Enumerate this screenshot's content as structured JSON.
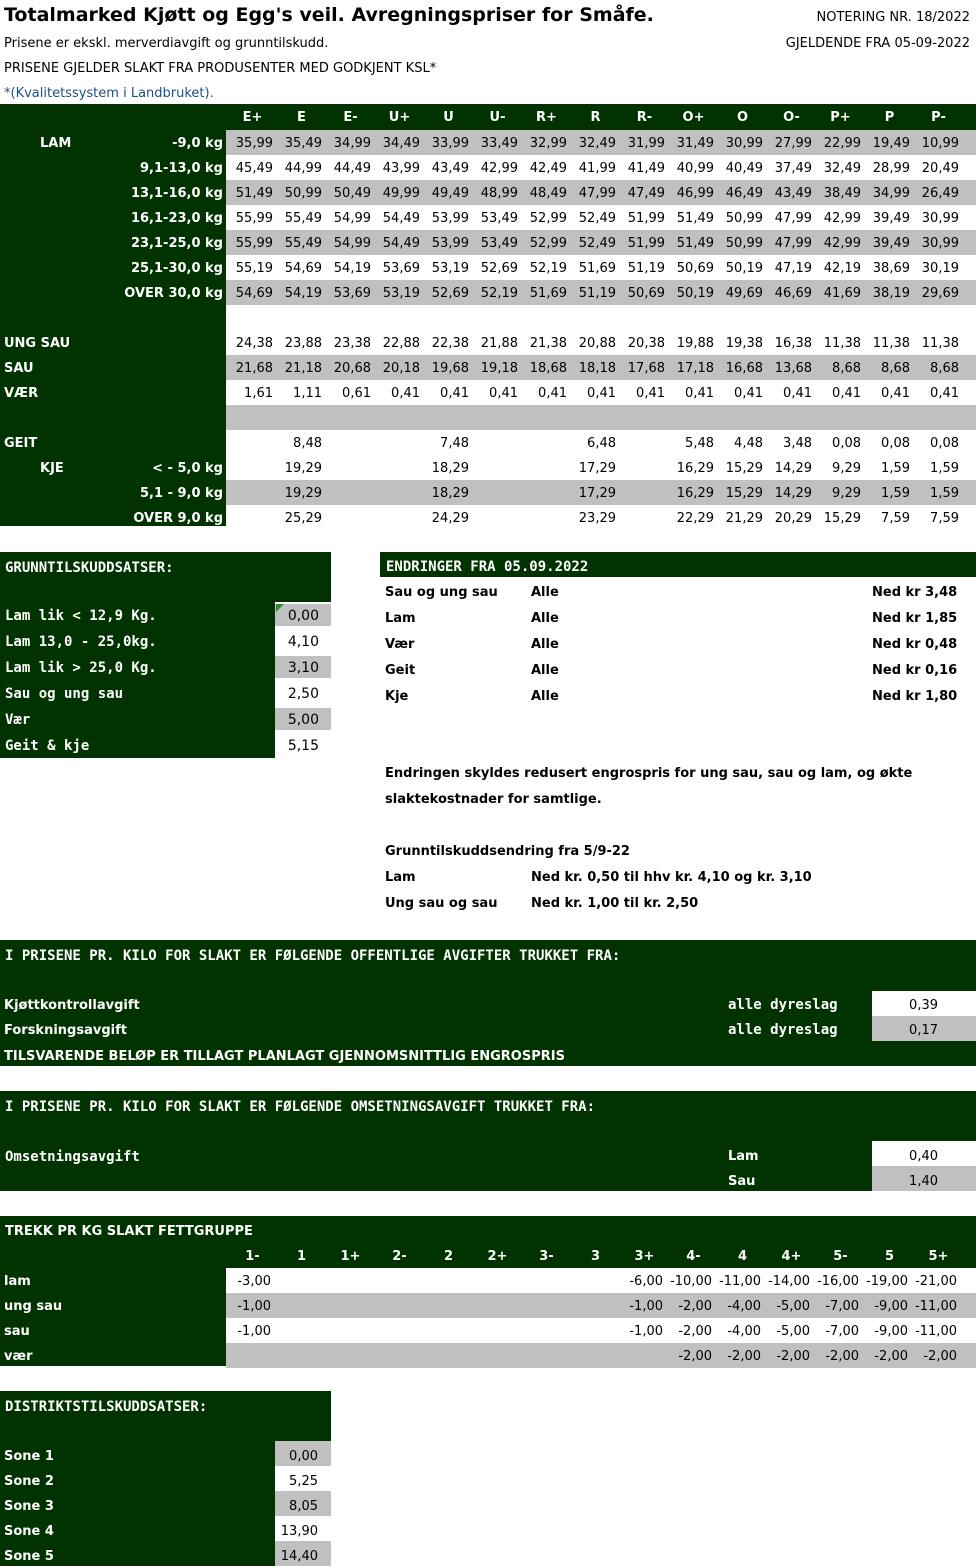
{
  "header": {
    "title": "Totalmarked Kjøtt og Egg's veil. Avregningspriser for Småfe.",
    "notering": "NOTERING NR. 18/2022",
    "subtitle": "Prisene er ekskl. merverdiavgift og grunntilskudd.",
    "gjeldende": "GJELDENDE FRA 05-09-2022",
    "ksl": "PRISENE GJELDER SLAKT FRA PRODUSENTER MED GODKJENT KSL*",
    "ksl_note": "*(Kvalitetssystem i Landbruket)."
  },
  "price_table": {
    "columns": [
      "E+",
      "E",
      "E-",
      "U+",
      "U",
      "U-",
      "R+",
      "R",
      "R-",
      "O+",
      "O",
      "O-",
      "P+",
      "P",
      "P-"
    ],
    "rows": [
      {
        "group": "LAM",
        "label": "-9,0 kg",
        "values": [
          "35,99",
          "35,49",
          "34,99",
          "34,49",
          "33,99",
          "33,49",
          "32,99",
          "32,49",
          "31,99",
          "31,49",
          "30,99",
          "27,99",
          "22,99",
          "19,49",
          "10,99"
        ]
      },
      {
        "group": "",
        "label": "9,1-13,0 kg",
        "values": [
          "45,49",
          "44,99",
          "44,49",
          "43,99",
          "43,49",
          "42,99",
          "42,49",
          "41,99",
          "41,49",
          "40,99",
          "40,49",
          "37,49",
          "32,49",
          "28,99",
          "20,49"
        ]
      },
      {
        "group": "",
        "label": "13,1-16,0 kg",
        "values": [
          "51,49",
          "50,99",
          "50,49",
          "49,99",
          "49,49",
          "48,99",
          "48,49",
          "47,99",
          "47,49",
          "46,99",
          "46,49",
          "43,49",
          "38,49",
          "34,99",
          "26,49"
        ]
      },
      {
        "group": "",
        "label": "16,1-23,0 kg",
        "values": [
          "55,99",
          "55,49",
          "54,99",
          "54,49",
          "53,99",
          "53,49",
          "52,99",
          "52,49",
          "51,99",
          "51,49",
          "50,99",
          "47,99",
          "42,99",
          "39,49",
          "30,99"
        ]
      },
      {
        "group": "",
        "label": "23,1-25,0 kg",
        "values": [
          "55,99",
          "55,49",
          "54,99",
          "54,49",
          "53,99",
          "53,49",
          "52,99",
          "52,49",
          "51,99",
          "51,49",
          "50,99",
          "47,99",
          "42,99",
          "39,49",
          "30,99"
        ]
      },
      {
        "group": "",
        "label": "25,1-30,0 kg",
        "values": [
          "55,19",
          "54,69",
          "54,19",
          "53,69",
          "53,19",
          "52,69",
          "52,19",
          "51,69",
          "51,19",
          "50,69",
          "50,19",
          "47,19",
          "42,19",
          "38,69",
          "30,19"
        ]
      },
      {
        "group": "",
        "label": "OVER 30,0 kg",
        "values": [
          "54,69",
          "54,19",
          "53,69",
          "53,19",
          "52,69",
          "52,19",
          "51,69",
          "51,19",
          "50,69",
          "50,19",
          "49,69",
          "46,69",
          "41,69",
          "38,19",
          "29,69"
        ]
      },
      {
        "group": "",
        "label": "",
        "values": [
          "",
          "",
          "",
          "",
          "",
          "",
          "",
          "",
          "",
          "",
          "",
          "",
          "",
          "",
          ""
        ]
      },
      {
        "group": "UNG SAU",
        "label": "",
        "values": [
          "24,38",
          "23,88",
          "23,38",
          "22,88",
          "22,38",
          "21,88",
          "21,38",
          "20,88",
          "20,38",
          "19,88",
          "19,38",
          "16,38",
          "11,38",
          "11,38",
          "11,38"
        ]
      },
      {
        "group": "SAU",
        "label": "",
        "values": [
          "21,68",
          "21,18",
          "20,68",
          "20,18",
          "19,68",
          "19,18",
          "18,68",
          "18,18",
          "17,68",
          "17,18",
          "16,68",
          "13,68",
          "8,68",
          "8,68",
          "8,68"
        ]
      },
      {
        "group": "VÆR",
        "label": "",
        "values": [
          "1,61",
          "1,11",
          "0,61",
          "0,41",
          "0,41",
          "0,41",
          "0,41",
          "0,41",
          "0,41",
          "0,41",
          "0,41",
          "0,41",
          "0,41",
          "0,41",
          "0,41"
        ]
      },
      {
        "group": "",
        "label": "",
        "values": [
          "",
          "",
          "",
          "",
          "",
          "",
          "",
          "",
          "",
          "",
          "",
          "",
          "",
          "",
          ""
        ]
      },
      {
        "group": "GEIT",
        "label": "",
        "values": [
          "",
          "8,48",
          "",
          "",
          "7,48",
          "",
          "",
          "6,48",
          "",
          "5,48",
          "4,48",
          "3,48",
          "0,08",
          "0,08",
          "0,08"
        ]
      },
      {
        "group": "KJE",
        "label": "< - 5,0 kg",
        "values": [
          "",
          "19,29",
          "",
          "",
          "18,29",
          "",
          "",
          "17,29",
          "",
          "16,29",
          "15,29",
          "14,29",
          "9,29",
          "1,59",
          "1,59"
        ]
      },
      {
        "group": "",
        "label": "5,1 - 9,0 kg",
        "values": [
          "",
          "19,29",
          "",
          "",
          "18,29",
          "",
          "",
          "17,29",
          "",
          "16,29",
          "15,29",
          "14,29",
          "9,29",
          "1,59",
          "1,59"
        ]
      },
      {
        "group": "",
        "label": "OVER 9,0 kg",
        "values": [
          "",
          "25,29",
          "",
          "",
          "24,29",
          "",
          "",
          "23,29",
          "",
          "22,29",
          "21,29",
          "20,29",
          "15,29",
          "7,59",
          "7,59"
        ]
      }
    ]
  },
  "grunntilskudd": {
    "title": "GRUNNTILSKUDDSATSER:",
    "rows": [
      {
        "label": "Lam lik < 12,9 Kg.",
        "value": "0,00"
      },
      {
        "label": "Lam 13,0 - 25,0kg.",
        "value": "4,10"
      },
      {
        "label": "Lam lik > 25,0 Kg.",
        "value": "3,10"
      },
      {
        "label": "Sau og ung sau",
        "value": "2,50"
      },
      {
        "label": "Vær",
        "value": "5,00"
      },
      {
        "label": "Geit & kje",
        "value": "5,15"
      }
    ]
  },
  "endringer": {
    "title": "ENDRINGER FRA 05.09.2022",
    "rows": [
      {
        "type": "Sau og ung sau",
        "scope": "Alle",
        "change": "Ned kr 3,48"
      },
      {
        "type": "Lam",
        "scope": "Alle",
        "change": "Ned kr 1,85"
      },
      {
        "type": "Vær",
        "scope": "Alle",
        "change": "Ned kr 0,48"
      },
      {
        "type": "Geit",
        "scope": "Alle",
        "change": "Ned kr 0,16"
      },
      {
        "type": "Kje",
        "scope": "Alle",
        "change": "Ned kr 1,80"
      }
    ],
    "reason_line1": "Endringen skyldes redusert engrospris for ung sau, sau og lam, og økte",
    "reason_line2": "slaktekostnader for samtlige.",
    "gt_title": "Grunntilskuddsendring fra 5/9-22",
    "gt_rows": [
      {
        "label": "Lam",
        "text": "Ned kr. 0,50 til hhv kr. 4,10 og kr. 3,10"
      },
      {
        "label": "Ung sau og sau",
        "text": "Ned kr. 1,00 til kr. 2,50"
      }
    ]
  },
  "offentlige": {
    "title": "I PRISENE PR. KILO FOR SLAKT ER FØLGENDE OFFENTLIGE AVGIFTER TRUKKET FRA:",
    "rows": [
      {
        "label": "Kjøttkontrollavgift",
        "scope": "alle dyreslag",
        "value": "0,39"
      },
      {
        "label": "Forskningsavgift",
        "scope": "alle dyreslag",
        "value": "0,17"
      }
    ],
    "footer": "TILSVARENDE BELØP ER TILLAGT PLANLAGT GJENNOMSNITTLIG ENGROSPRIS"
  },
  "omsetning": {
    "title": "I PRISENE PR. KILO FOR SLAKT ER FØLGENDE OMSETNINGSAVGIFT TRUKKET FRA:",
    "label": "Omsetningsavgift",
    "rows": [
      {
        "type": "Lam",
        "value": "0,40"
      },
      {
        "type": "Sau",
        "value": "1,40"
      }
    ]
  },
  "fettgruppe": {
    "title": "TREKK PR KG SLAKT FETTGRUPPE",
    "columns": [
      "1-",
      "1",
      "1+",
      "2-",
      "2",
      "2+",
      "3-",
      "3",
      "3+",
      "4-",
      "4",
      "4+",
      "5-",
      "5",
      "5+"
    ],
    "rows": [
      {
        "label": "lam",
        "values": [
          "-3,00",
          "",
          "",
          "",
          "",
          "",
          "",
          "",
          "-6,00",
          "-10,00",
          "-11,00",
          "-14,00",
          "-16,00",
          "-19,00",
          "-21,00"
        ]
      },
      {
        "label": "ung sau",
        "values": [
          "-1,00",
          "",
          "",
          "",
          "",
          "",
          "",
          "",
          "-1,00",
          "-2,00",
          "-4,00",
          "-5,00",
          "-7,00",
          "-9,00",
          "-11,00"
        ]
      },
      {
        "label": "sau",
        "values": [
          "-1,00",
          "",
          "",
          "",
          "",
          "",
          "",
          "",
          "-1,00",
          "-2,00",
          "-4,00",
          "-5,00",
          "-7,00",
          "-9,00",
          "-11,00"
        ]
      },
      {
        "label": "vær",
        "values": [
          "",
          "",
          "",
          "",
          "",
          "",
          "",
          "",
          "",
          "-2,00",
          "-2,00",
          "-2,00",
          "-2,00",
          "-2,00",
          "-2,00"
        ]
      }
    ]
  },
  "distrikt": {
    "title": "DISTRIKTSTILSKUDDSATSER:",
    "rows": [
      {
        "label": "Sone 1",
        "value": "0,00"
      },
      {
        "label": "Sone 2",
        "value": "5,25"
      },
      {
        "label": "Sone 3",
        "value": "8,05"
      },
      {
        "label": "Sone 4",
        "value": "13,90"
      },
      {
        "label": "Sone 5",
        "value": "14,40"
      }
    ]
  }
}
